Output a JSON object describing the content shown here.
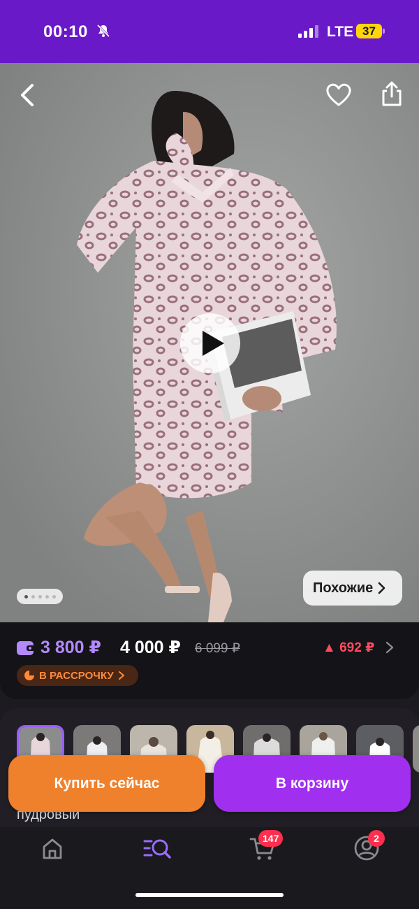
{
  "status": {
    "time": "00:10",
    "network": "LTE",
    "battery": "37"
  },
  "hero": {
    "similar_label": "Похожие",
    "slides_total": 5,
    "slide_active": 1
  },
  "price": {
    "wallet_price": "3 800 ₽",
    "price": "4 000 ₽",
    "old_price": "6 099 ₽",
    "drop": "▲ 692 ₽",
    "installment": "В РАССРОЧКУ"
  },
  "gallery": {
    "color_name": "пудровый",
    "thumbs": 8
  },
  "actions": {
    "buy_now": "Купить сейчас",
    "to_cart": "В корзину"
  },
  "tabbar": {
    "cart_badge": "147",
    "profile_badge": "2"
  },
  "colors": {
    "accent": "#6a19c9",
    "wallet": "#b389ff",
    "buy": "#f0812c",
    "cart": "#a02ff0",
    "badge": "#ff2e4d"
  }
}
